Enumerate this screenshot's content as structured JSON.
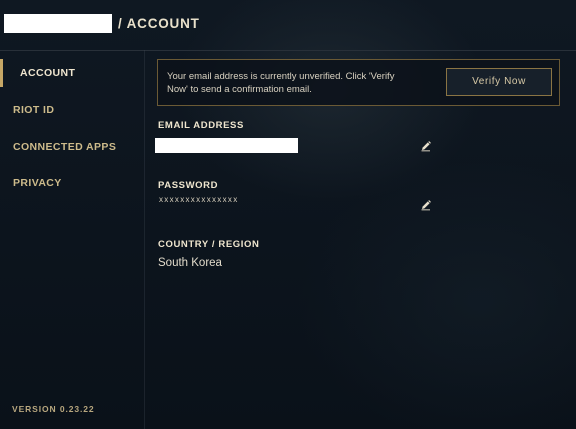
{
  "header": {
    "breadcrumb_separator_title": "/ ACCOUNT"
  },
  "sidebar": {
    "items": [
      {
        "label": "ACCOUNT",
        "active": true
      },
      {
        "label": "RIOT ID",
        "active": false
      },
      {
        "label": "CONNECTED APPS",
        "active": false
      },
      {
        "label": "PRIVACY",
        "active": false
      }
    ],
    "version": "VERSION 0.23.22"
  },
  "notice": {
    "text": "Your email address is currently unverified. Click 'Verify Now' to send a confirmation email.",
    "button_label": "Verify Now"
  },
  "fields": {
    "email_label": "EMAIL ADDRESS",
    "password_label": "PASSWORD",
    "password_value": "xxxxxxxxxxxxxxx",
    "country_label": "COUNTRY / REGION",
    "country_value": "South Korea"
  },
  "icons": {
    "edit": "pencil-icon"
  },
  "colors": {
    "accent_gold": "#c6a766",
    "background": "#0c131c",
    "notice_border": "#6b5a35"
  }
}
